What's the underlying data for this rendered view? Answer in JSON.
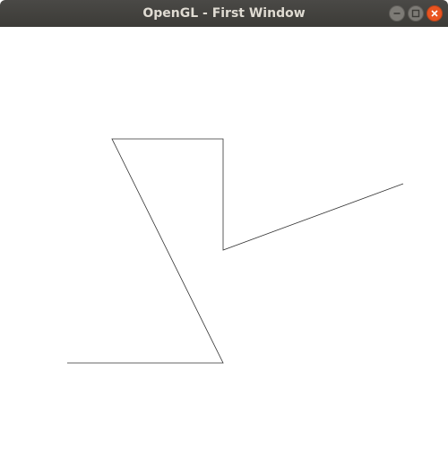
{
  "window": {
    "title": "OpenGL - First Window",
    "controls": {
      "minimize_icon": "minimize-icon",
      "maximize_icon": "maximize-icon",
      "close_icon": "close-icon"
    }
  },
  "colors": {
    "titlebar": "#3c3b37",
    "title_text": "#dfdbd2",
    "close_button": "#e95420",
    "line": "#333333",
    "background": "#ffffff"
  }
}
